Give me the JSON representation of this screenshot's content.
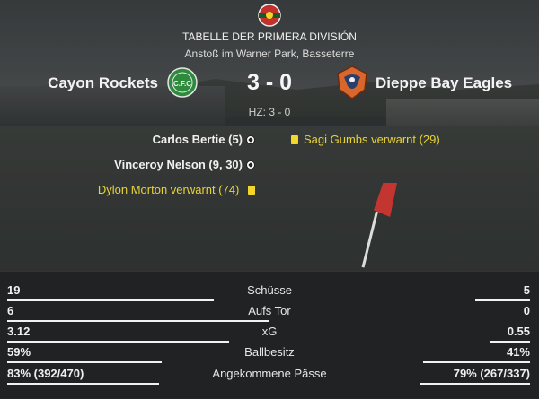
{
  "header": {
    "competition": "TABELLE DER PRIMERA DIVISIÓN",
    "venue": "Anstoß im Warner Park, Basseterre",
    "halftime": "HZ: 3 - 0"
  },
  "match": {
    "home_team": "Cayon Rockets",
    "away_team": "Dieppe Bay Eagles",
    "score": "3 - 0",
    "home_crest_text": "C.F.C",
    "home_color": "#2e8b3e",
    "away_color": "#d9662b"
  },
  "events": {
    "home": [
      {
        "text": "Carlos Bertie (5)",
        "icon": "goal-icon"
      },
      {
        "text": "Vinceroy Nelson (9, 30)",
        "icon": "goal-icon"
      },
      {
        "text": "Dylon Morton verwarnt (74)",
        "icon": "yellow-card-icon"
      }
    ],
    "away": [
      {
        "text": "Sagi Gumbs verwarnt (29)",
        "icon": "yellow-card-icon"
      }
    ]
  },
  "stats": [
    {
      "label": "Schüsse",
      "home": "19",
      "away": "5",
      "home_share": 0.79
    },
    {
      "label": "Aufs Tor",
      "home": "6",
      "away": "0",
      "home_share": 1.0
    },
    {
      "label": "xG",
      "home": "3.12",
      "away": "0.55",
      "home_share": 0.85
    },
    {
      "label": "Ballbesitz",
      "home": "59%",
      "away": "41%",
      "home_share": 0.59
    },
    {
      "label": "Angekommene Pässe",
      "home": "83% (392/470)",
      "away": "79% (267/337)",
      "home_share": 0.58
    }
  ]
}
